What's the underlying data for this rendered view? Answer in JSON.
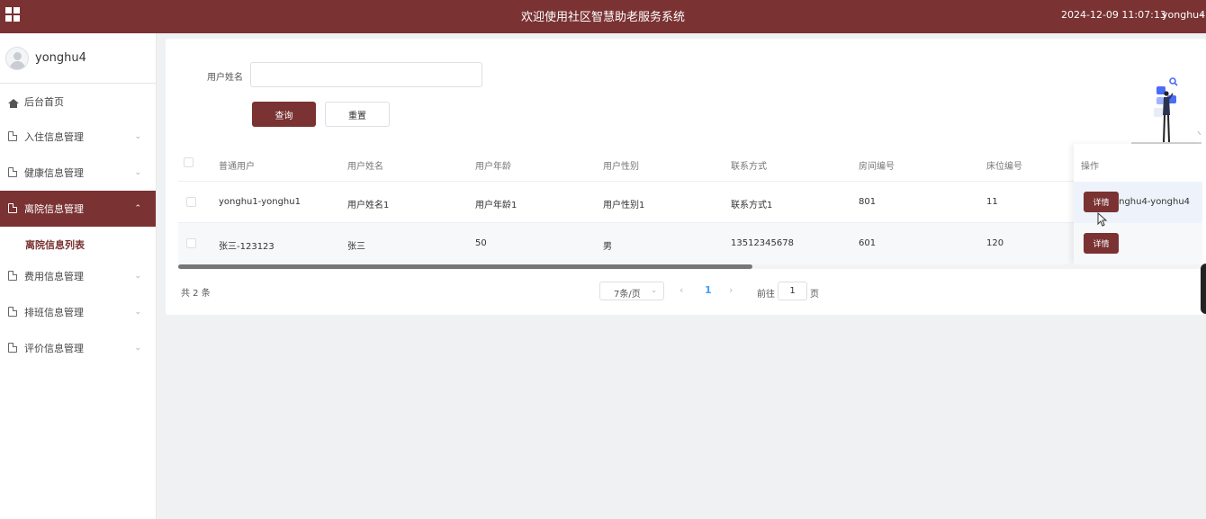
{
  "header": {
    "title": "欢迎使用社区智慧助老服务系统",
    "datetime": "2024-12-09 11:07:13",
    "username": "yonghu4",
    "caret": "⌄"
  },
  "sidebar": {
    "username": "yonghu4",
    "items": [
      {
        "label": "后台首页",
        "icon": "home-icon"
      },
      {
        "label": "入住信息管理",
        "icon": "document-icon"
      },
      {
        "label": "健康信息管理",
        "icon": "document-icon"
      },
      {
        "label": "离院信息管理",
        "icon": "document-icon"
      },
      {
        "label": "费用信息管理",
        "icon": "document-icon"
      },
      {
        "label": "排班信息管理",
        "icon": "document-icon"
      },
      {
        "label": "评价信息管理",
        "icon": "document-icon"
      }
    ],
    "active_item": "离院信息管理",
    "sub_item": "离院信息列表"
  },
  "search": {
    "label": "用户姓名",
    "value": "",
    "query_label": "查询",
    "reset_label": "重置"
  },
  "table": {
    "columns": [
      "普通用户",
      "用户姓名",
      "用户年龄",
      "用户性别",
      "联系方式",
      "房间编号",
      "床位编号",
      "操作"
    ],
    "rows": [
      [
        "yonghu1-yonghu1",
        "用户姓名1",
        "用户年龄1",
        "用户性别1",
        "联系方式1",
        "801",
        "11"
      ],
      [
        "张三-123123",
        "张三",
        "50",
        "男",
        "13512345678",
        "601",
        "120"
      ]
    ],
    "overflow_text": "onghu4-yonghu4",
    "detail_label": "详情"
  },
  "pagination": {
    "total": "共 2 条",
    "page_size": "7条/页",
    "current_page": "1",
    "goto_label": "前往",
    "goto_value": "1",
    "page_unit": "页"
  },
  "colors": {
    "brand": "#7a3232",
    "link": "#409eff"
  }
}
